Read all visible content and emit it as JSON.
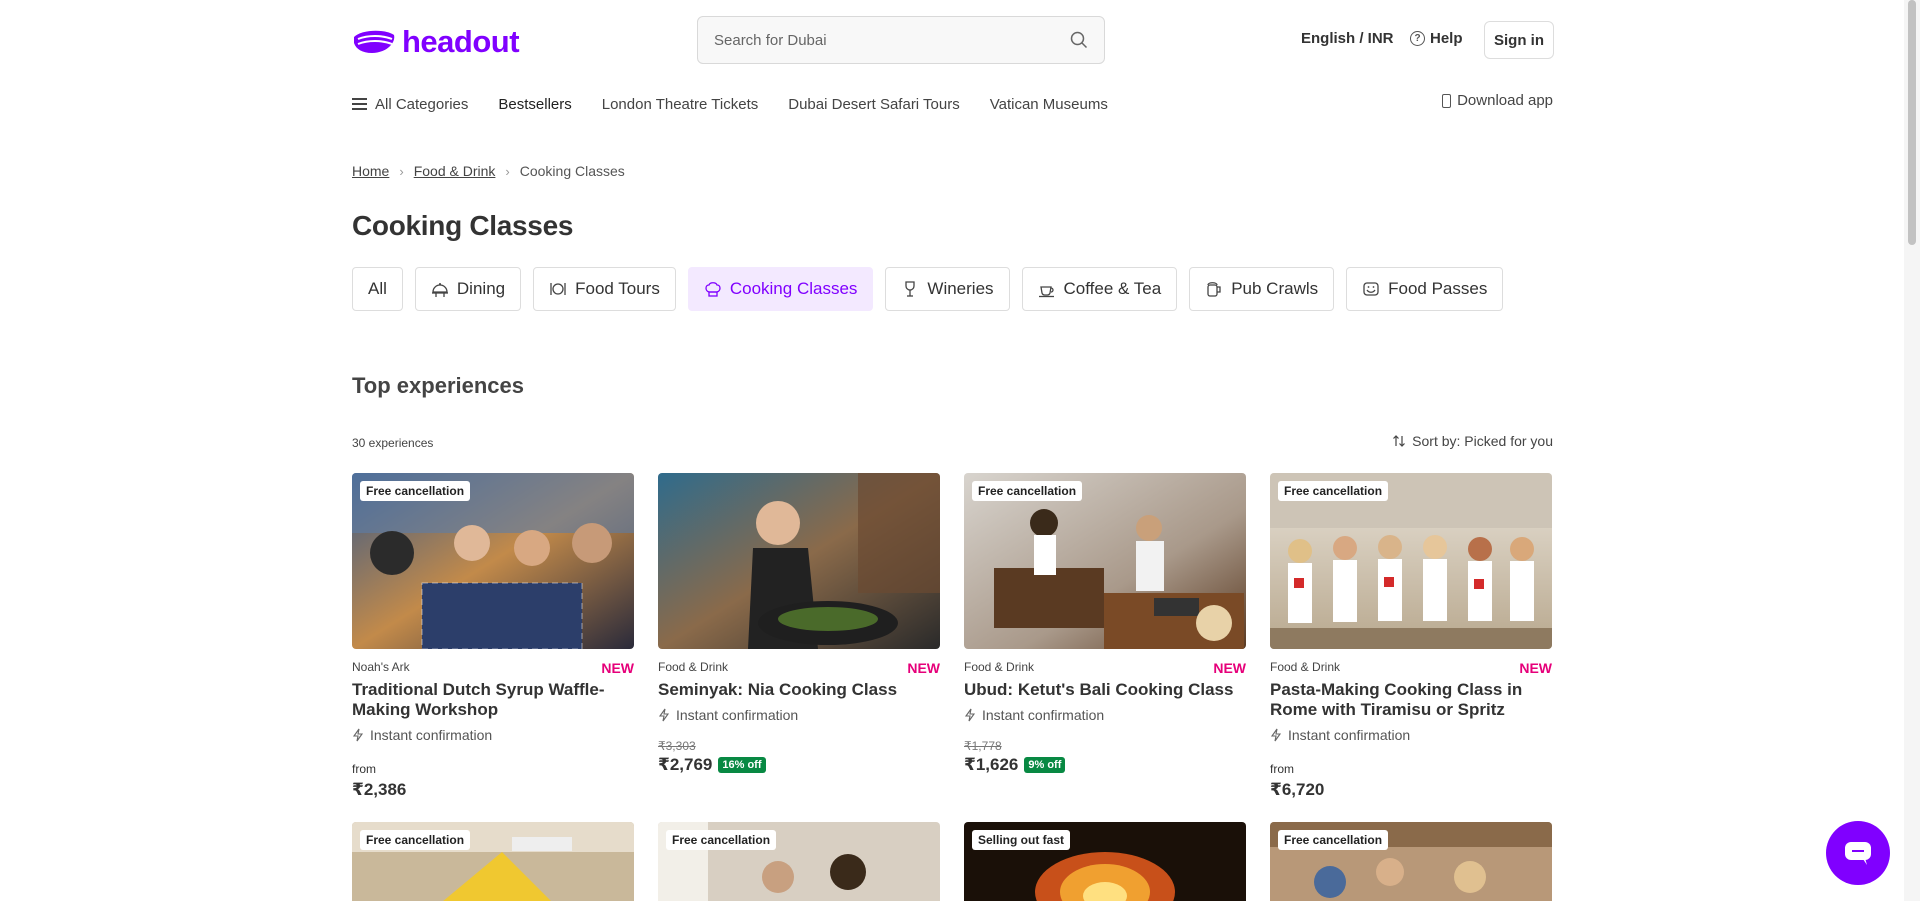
{
  "header": {
    "logo_text": "headout",
    "search_placeholder": "Search for Dubai",
    "language": "English / INR",
    "help": "Help",
    "sign_in": "Sign in"
  },
  "nav": {
    "all_categories": "All Categories",
    "items": [
      "Bestsellers",
      "London Theatre Tickets",
      "Dubai Desert Safari Tours",
      "Vatican Museums"
    ],
    "download_app": "Download app"
  },
  "breadcrumb": {
    "home": "Home",
    "category": "Food & Drink",
    "current": "Cooking Classes"
  },
  "page_title": "Cooking Classes",
  "chips": [
    {
      "label": "All",
      "icon": null
    },
    {
      "label": "Dining",
      "icon": "dining-icon"
    },
    {
      "label": "Food Tours",
      "icon": "food-tours-icon"
    },
    {
      "label": "Cooking Classes",
      "icon": "chef-hat-icon"
    },
    {
      "label": "Wineries",
      "icon": "wine-glass-icon"
    },
    {
      "label": "Coffee & Tea",
      "icon": "coffee-cup-icon"
    },
    {
      "label": "Pub Crawls",
      "icon": "beer-mug-icon"
    },
    {
      "label": "Food Passes",
      "icon": "food-pass-icon"
    }
  ],
  "active_chip": "Cooking Classes",
  "section": {
    "title": "Top experiences",
    "count": "30 experiences",
    "sort": "Sort by: Picked for you"
  },
  "cards": [
    {
      "tag": "Free cancellation",
      "category": "Noah's Ark",
      "badge": "NEW",
      "title": "Traditional Dutch Syrup Waffle-Making Workshop",
      "confirmation": "Instant confirmation",
      "from": "from",
      "price": "₹2,386"
    },
    {
      "tag": "",
      "category": "Food & Drink",
      "badge": "NEW",
      "title": "Seminyak: Nia Cooking Class",
      "confirmation": "Instant confirmation",
      "original_price": "₹3,303",
      "price": "₹2,769",
      "discount": "16% off"
    },
    {
      "tag": "Free cancellation",
      "category": "Food & Drink",
      "badge": "NEW",
      "title": "Ubud: Ketut's Bali Cooking Class",
      "confirmation": "Instant confirmation",
      "original_price": "₹1,778",
      "price": "₹1,626",
      "discount": "9% off"
    },
    {
      "tag": "Free cancellation",
      "category": "Food & Drink",
      "badge": "NEW",
      "title": "Pasta-Making Cooking Class in Rome with Tiramisu or Spritz",
      "confirmation": "Instant confirmation",
      "from": "from",
      "price": "₹6,720"
    }
  ],
  "row2_tags": [
    "Free cancellation",
    "Free cancellation",
    "Selling out fast",
    "Free cancellation"
  ],
  "colors": {
    "brand": "#8000ff",
    "new_badge": "#e6007a",
    "discount": "#088943",
    "active_chip_bg": "#f3e9ff"
  }
}
